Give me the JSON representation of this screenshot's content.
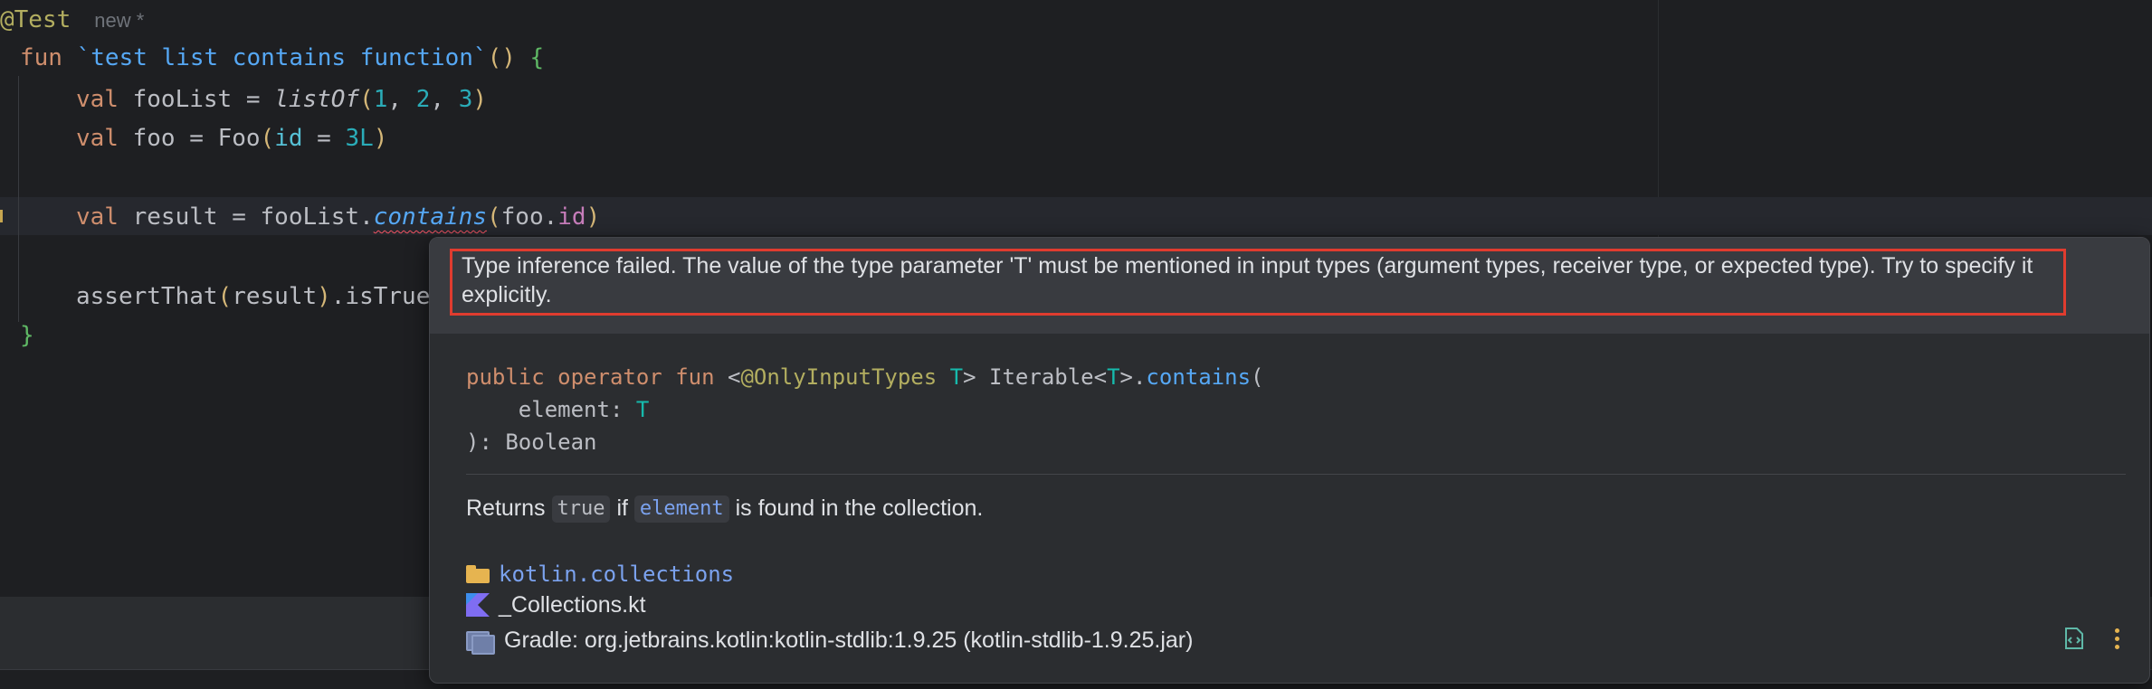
{
  "editor": {
    "annotation": "@Test",
    "status_label": "new *",
    "lines": {
      "fun_kw": "fun",
      "fun_name": "`test list contains function`",
      "fun_parens": "()",
      "fun_open_brace": "{",
      "l1_kw": "val",
      "l1_name": "fooList",
      "l1_eq": "=",
      "l1_call": "listOf",
      "l1_args_a": "1",
      "l1_args_b": "2",
      "l1_args_c": "3",
      "l2_kw": "val",
      "l2_name": "foo",
      "l2_eq": "=",
      "l2_call": "Foo",
      "l2_param": "id",
      "l2_value": "3L",
      "l3_kw": "val",
      "l3_name": "result",
      "l3_eq": "=",
      "l3_receiver": "fooList.",
      "l3_call": "contains",
      "l3_arg_obj": "foo.",
      "l3_arg_prop": "id",
      "l4_call": "assertThat",
      "l4_arg": "result",
      "l4_tail": ".isTrue",
      "close_brace": "}"
    }
  },
  "popup": {
    "error_text": "Type inference failed. The value of the type parameter 'T' must be mentioned in input types (argument types, receiver type, or expected type). Try to specify it explicitly.",
    "signature": {
      "mods": "public operator fun",
      "lt": "<",
      "annotation": "@OnlyInputTypes",
      "tparam": "T",
      "gt": ">",
      "receiver": "Iterable<",
      "receiver_t": "T",
      "receiver_close": ">.",
      "fname": "contains",
      "open": "(",
      "param_name": "element:",
      "param_type": "T",
      "close": "):",
      "ret": "Boolean"
    },
    "description": {
      "pre": "Returns",
      "chip1": "true",
      "mid": "if",
      "chip2": "element",
      "post": "is found in the collection."
    },
    "package": "kotlin.collections",
    "file": "_Collections.kt",
    "library": "Gradle: org.jetbrains.kotlin:kotlin-stdlib:1.9.25 (kotlin-stdlib-1.9.25.jar)",
    "icons": {
      "package": "folder-icon",
      "file": "kotlin-file-icon",
      "library": "library-icon",
      "edit_source": "edit-source-icon",
      "more": "more-options-icon"
    }
  }
}
